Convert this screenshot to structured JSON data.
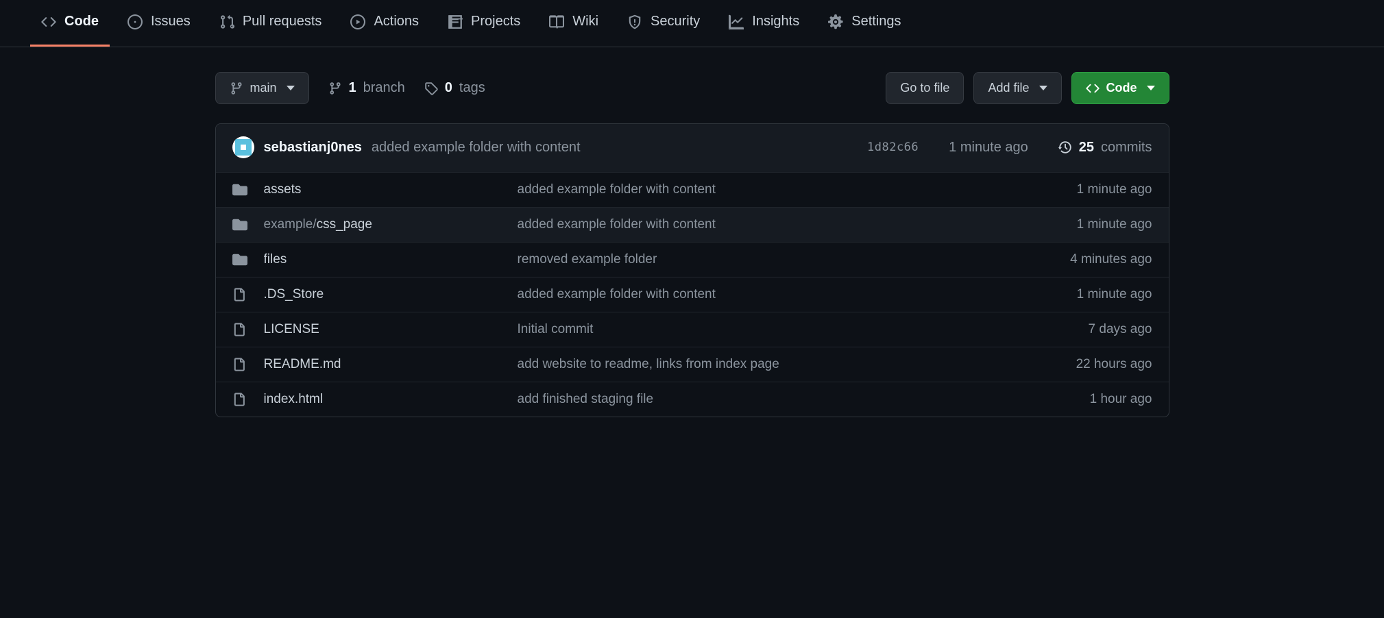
{
  "nav": {
    "tabs": [
      {
        "id": "code",
        "label": "Code"
      },
      {
        "id": "issues",
        "label": "Issues"
      },
      {
        "id": "pulls",
        "label": "Pull requests"
      },
      {
        "id": "actions",
        "label": "Actions"
      },
      {
        "id": "projects",
        "label": "Projects"
      },
      {
        "id": "wiki",
        "label": "Wiki"
      },
      {
        "id": "security",
        "label": "Security"
      },
      {
        "id": "insights",
        "label": "Insights"
      },
      {
        "id": "settings",
        "label": "Settings"
      }
    ],
    "active": "code"
  },
  "branch_switcher": {
    "label": "main"
  },
  "branches": {
    "count": "1",
    "word": "branch"
  },
  "tags": {
    "count": "0",
    "word": "tags"
  },
  "buttons": {
    "go_to_file": "Go to file",
    "add_file": "Add file",
    "code": "Code"
  },
  "latest_commit": {
    "author": "sebastianj0nes",
    "message": "added example folder with content",
    "sha": "1d82c66",
    "time": "1 minute ago"
  },
  "commits": {
    "count": "25",
    "word": "commits"
  },
  "files": [
    {
      "kind": "dir",
      "name": "assets",
      "path_prefix": "",
      "msg": "added example folder with content",
      "time": "1 minute ago"
    },
    {
      "kind": "dir",
      "name": "css_page",
      "path_prefix": "example/",
      "msg": "added example folder with content",
      "time": "1 minute ago"
    },
    {
      "kind": "dir",
      "name": "files",
      "path_prefix": "",
      "msg": "removed example folder",
      "time": "4 minutes ago"
    },
    {
      "kind": "file",
      "name": ".DS_Store",
      "path_prefix": "",
      "msg": "added example folder with content",
      "time": "1 minute ago"
    },
    {
      "kind": "file",
      "name": "LICENSE",
      "path_prefix": "",
      "msg": "Initial commit",
      "time": "7 days ago"
    },
    {
      "kind": "file",
      "name": "README.md",
      "path_prefix": "",
      "msg": "add website to readme, links from index page",
      "time": "22 hours ago"
    },
    {
      "kind": "file",
      "name": "index.html",
      "path_prefix": "",
      "msg": "add finished staging file",
      "time": "1 hour ago"
    }
  ]
}
